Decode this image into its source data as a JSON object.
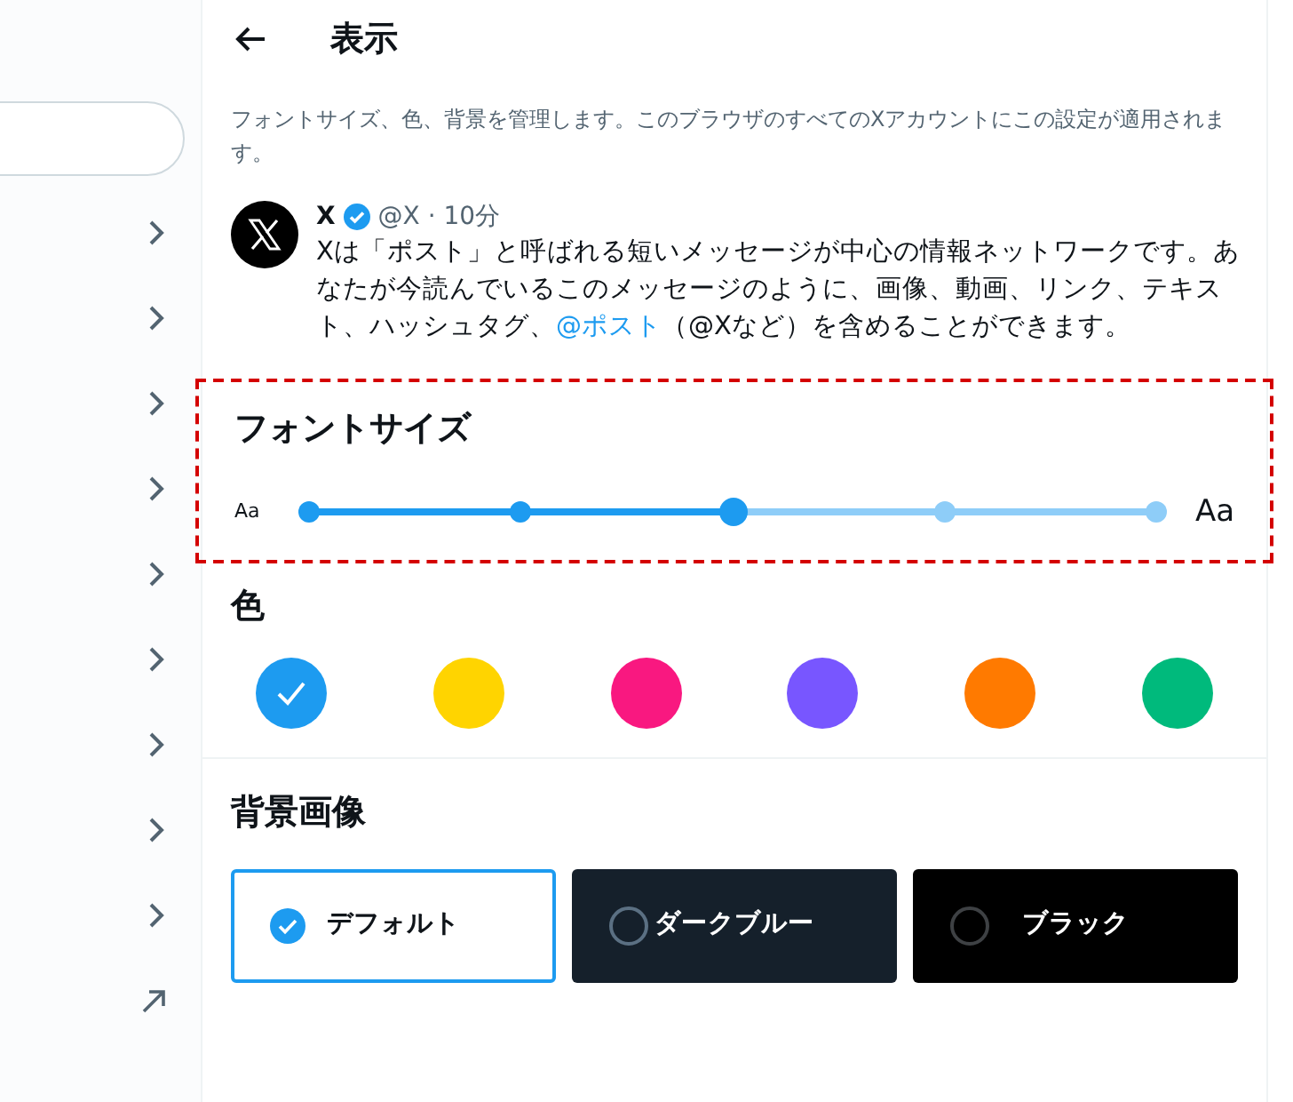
{
  "sidebar": {
    "items": [
      {
        "kind": "chevron"
      },
      {
        "kind": "chevron"
      },
      {
        "kind": "chevron"
      },
      {
        "kind": "chevron"
      },
      {
        "kind": "chevron"
      },
      {
        "kind": "chevron"
      },
      {
        "kind": "chevron"
      },
      {
        "kind": "chevron"
      },
      {
        "kind": "chevron"
      },
      {
        "kind": "external"
      }
    ]
  },
  "header": {
    "title": "表示"
  },
  "description": "フォントサイズ、色、背景を管理します。このブラウザのすべてのXアカウントにこの設定が適用されます。",
  "post": {
    "name": "X",
    "verified": true,
    "handle": "@X · 10分",
    "body": [
      {
        "kind": "plain",
        "text": "Xは「ポスト」と呼ばれる短いメッセージが中心の情報ネットワークです。あなたが今読んでいるこのメッセージのように、画像、動画、リンク、テキスト、ハッシュタグ、"
      },
      {
        "kind": "mention",
        "text": "@ポスト"
      },
      {
        "kind": "plain",
        "text": "（@Xなど）を含めることができます。"
      }
    ]
  },
  "font_size": {
    "title": "フォントサイズ",
    "highlighted": true,
    "small_label": "Aa",
    "large_label": "Aa",
    "level": 0.5,
    "stops": [
      {
        "selected": false
      },
      {
        "selected": false
      },
      {
        "selected": true
      },
      {
        "selected": false
      },
      {
        "selected": false
      }
    ]
  },
  "colors": {
    "title": "色",
    "swatches": [
      {
        "color": "#1d9bf0",
        "selected": true
      },
      {
        "color": "#ffd400",
        "selected": false
      },
      {
        "color": "#f91880",
        "selected": false
      },
      {
        "color": "#7856ff",
        "selected": false
      },
      {
        "color": "#ff7a00",
        "selected": false
      },
      {
        "color": "#00ba7c",
        "selected": false
      }
    ]
  },
  "background": {
    "title": "背景画像",
    "options": [
      {
        "kind": "light",
        "label": "デフォルト",
        "selected": true
      },
      {
        "kind": "dim",
        "label": "ダークブルー",
        "selected": false
      },
      {
        "kind": "dark",
        "label": "ブラック",
        "selected": false
      }
    ]
  }
}
